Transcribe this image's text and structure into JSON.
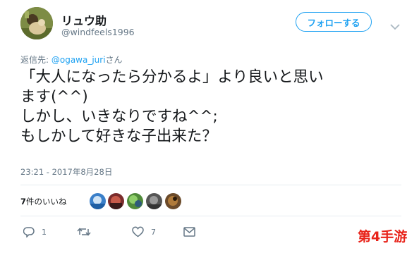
{
  "user": {
    "display_name": "リュウ助",
    "handle": "@windfeels1996"
  },
  "follow_button": {
    "label": "フォローする"
  },
  "reply": {
    "prefix": "返信先: ",
    "mention": "@ogawa_juri",
    "suffix": "さん"
  },
  "tweet": {
    "lines": [
      "「大人になったら分かるよ」より良いと思い",
      "ます(^^)",
      "しかし、いきなりですね^^;",
      "もしかして好きな子出来た？"
    ],
    "timestamp": "23:21 - 2017年8月28日"
  },
  "likes": {
    "count": "7",
    "label": "件のいいね"
  },
  "actions": {
    "reply_count": "1",
    "retweet_count": "",
    "like_count": "7"
  },
  "watermark": {
    "text": "第4手游"
  },
  "colors": {
    "accent": "#1da1f2",
    "muted": "#657786",
    "divider": "#e6ecf0",
    "watermark": "#e8231a"
  }
}
